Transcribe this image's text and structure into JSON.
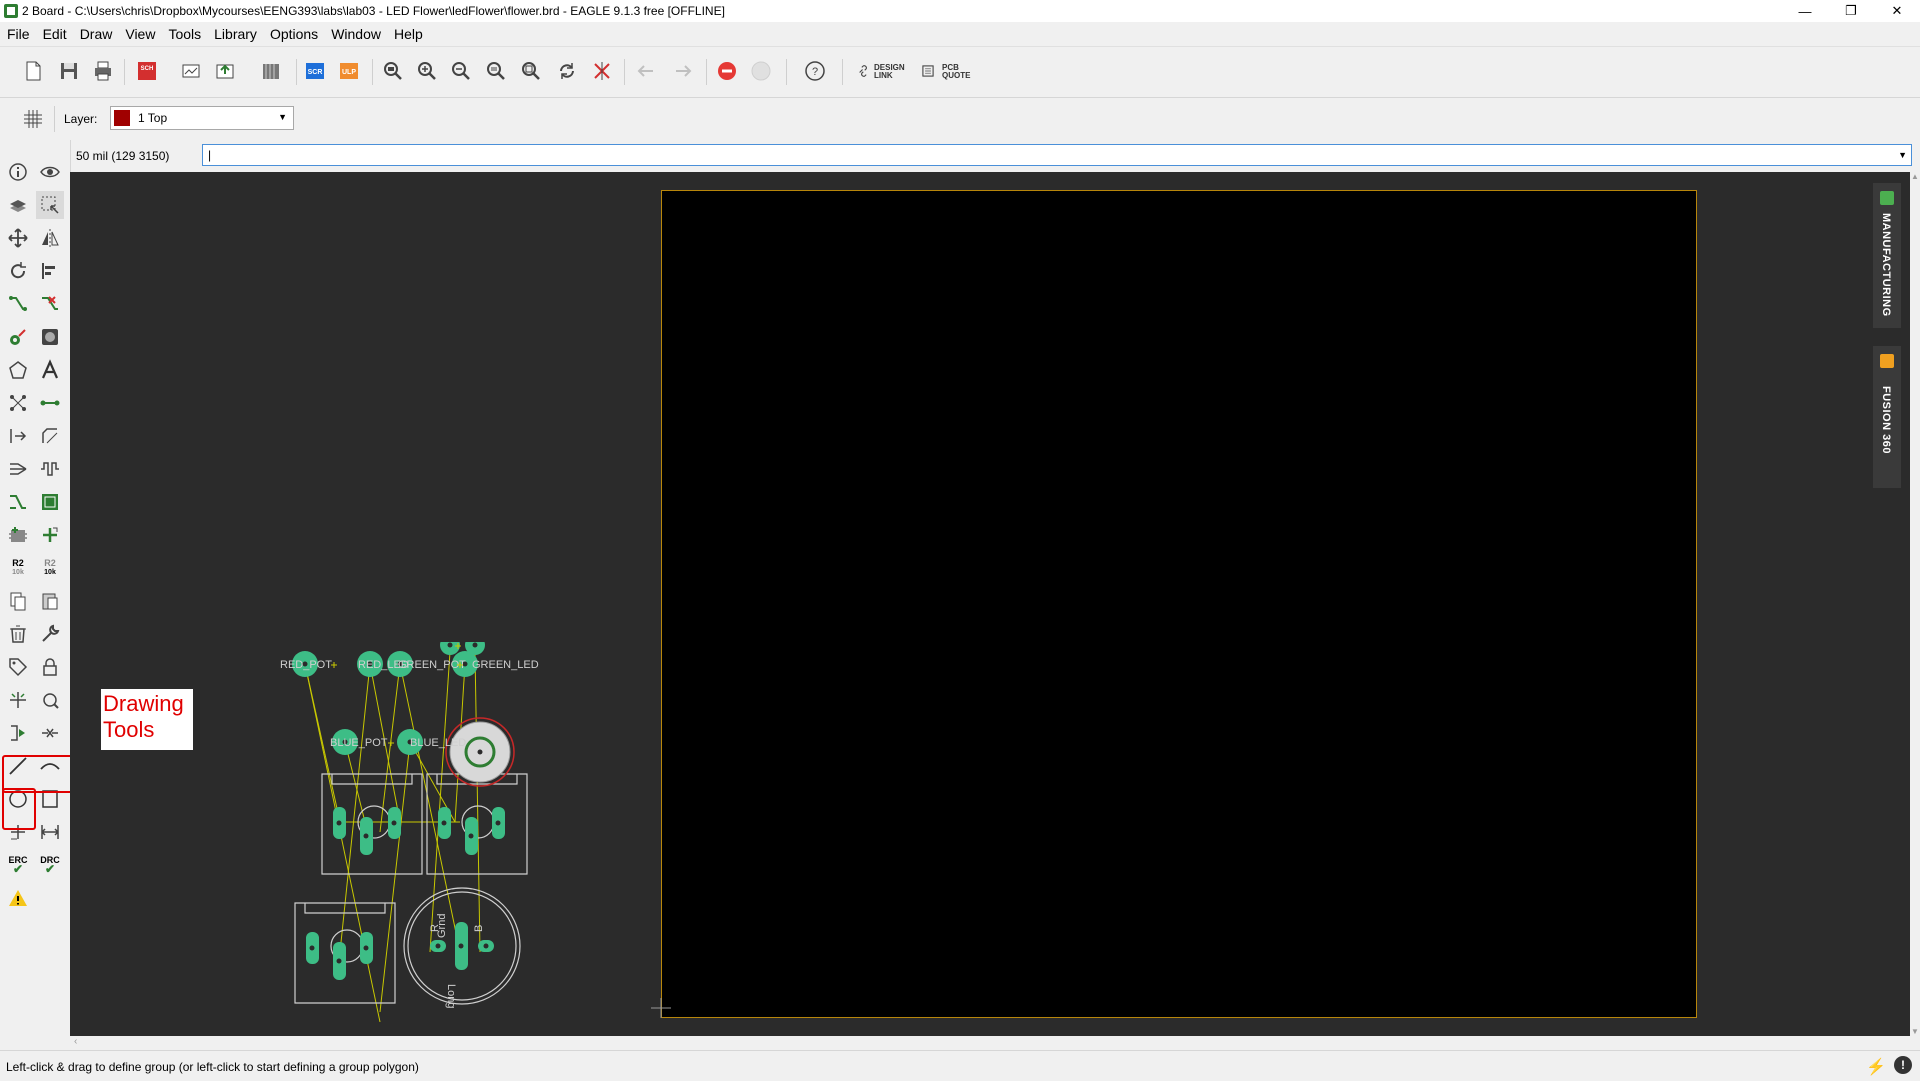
{
  "window": {
    "title": "2 Board - C:\\Users\\chris\\Dropbox\\Mycourses\\EENG393\\labs\\lab03 - LED Flower\\ledFlower\\flower.brd - EAGLE 9.1.3 free [OFFLINE]",
    "minimize": "—",
    "restore": "❐",
    "close": "✕"
  },
  "menu": [
    "File",
    "Edit",
    "Draw",
    "View",
    "Tools",
    "Library",
    "Options",
    "Window",
    "Help"
  ],
  "toolbar": {
    "sch_label": "SCH",
    "scr_label": "SCR",
    "ulp_label": "ULP",
    "design_link": [
      "DESIGN",
      "LINK"
    ],
    "pcb_quote": [
      "PCB",
      "QUOTE"
    ],
    "help": "?"
  },
  "layer": {
    "label": "Layer:",
    "selected": "1 Top",
    "color": "#a00000"
  },
  "command": {
    "coordinates": "50 mil (129 3150)",
    "value": "|"
  },
  "left_tools": {
    "r2_label": "R2",
    "r2_sub": "10k",
    "r2b_label": "R2",
    "r2b_sub": "10k",
    "erc": "ERC",
    "drc": "DRC"
  },
  "annotation": {
    "line1": "Drawing",
    "line2": "Tools"
  },
  "board_labels": [
    "RED_POT",
    "RED_LED",
    "GREEN_POT",
    "GREEN_LED",
    "BLUE_POT",
    "BLUE_LED",
    "Grnd",
    "B",
    "R",
    "Long"
  ],
  "side_tabs": {
    "manufacturing": "MANUFACTURING",
    "fusion": "FUSION 360",
    "manufacturing_badge": "#4caf50",
    "fusion_badge": "#f0a020"
  },
  "status": {
    "text": "Left-click & drag to define group (or left-click to start defining a group polygon)"
  },
  "colors": {
    "pad": "#3dbd86",
    "airwire": "#c8c800",
    "board_outline": "#b8860b",
    "silkscreen": "#cfcfcf"
  }
}
